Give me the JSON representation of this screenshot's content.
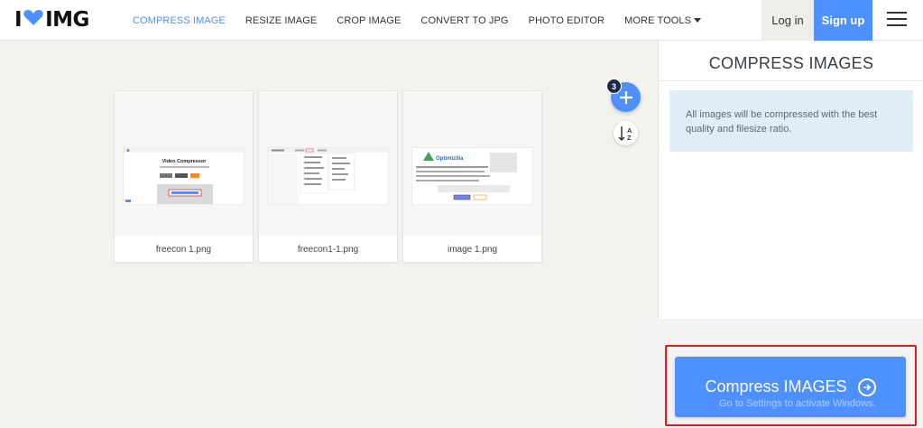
{
  "header": {
    "logo_left": "I",
    "logo_right": "IMG",
    "nav": [
      {
        "label": "COMPRESS IMAGE",
        "active": true
      },
      {
        "label": "RESIZE IMAGE",
        "active": false
      },
      {
        "label": "CROP IMAGE",
        "active": false
      },
      {
        "label": "CONVERT TO JPG",
        "active": false
      },
      {
        "label": "PHOTO EDITOR",
        "active": false
      },
      {
        "label": "MORE TOOLS",
        "active": false,
        "dropdown": true
      }
    ],
    "login": "Log in",
    "signup": "Sign up"
  },
  "files": [
    {
      "name": "freecon 1.png",
      "thumb_heading": "Video Compressor"
    },
    {
      "name": "freecon1-1.png"
    },
    {
      "name": "image 1.png",
      "thumb_logo": "Optimizilla"
    }
  ],
  "toolbar": {
    "file_count": "3",
    "sort_label_top": "A",
    "sort_label_bottom": "Z"
  },
  "sidebar": {
    "title": "COMPRESS IMAGES",
    "info": "All images will be compressed with the best quality and filesize ratio.",
    "button_label": "Compress IMAGES"
  },
  "overlay": {
    "watermark": "Go to Settings to activate Windows."
  },
  "colors": {
    "accent": "#4d90fe",
    "info_bg": "#dfeef6",
    "highlight": "#e21b1b",
    "logo_heart": "#4d90fe"
  }
}
